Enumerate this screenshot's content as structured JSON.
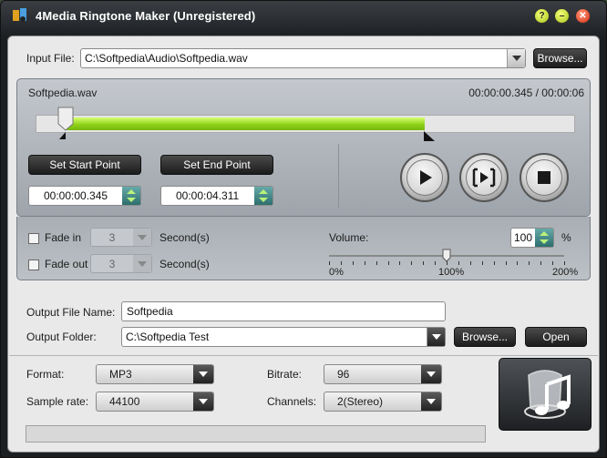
{
  "window": {
    "title": "4Media Ringtone Maker (Unregistered)",
    "help_symbol": "?",
    "min_symbol": "–",
    "close_symbol": "✕"
  },
  "input": {
    "label": "Input File:",
    "value": "C:\\Softpedia\\Audio\\Softpedia.wav",
    "browse_label": "Browse..."
  },
  "clip": {
    "filename": "Softpedia.wav",
    "time_display": "00:00:00.345 / 00:00:06",
    "start_fraction": 0.055,
    "end_fraction": 0.72
  },
  "start": {
    "button_label": "Set Start Point",
    "value": "00:00:00.345"
  },
  "end": {
    "button_label": "Set End Point",
    "value": "00:00:04.311"
  },
  "playback": {
    "play_icon": "play-icon",
    "segment_icon": "play-selection-icon",
    "stop_icon": "stop-icon"
  },
  "fade_in": {
    "label": "Fade in",
    "value": "3",
    "unit": "Second(s)",
    "checked": false
  },
  "fade_out": {
    "label": "Fade out",
    "value": "3",
    "unit": "Second(s)",
    "checked": false
  },
  "volume": {
    "label": "Volume:",
    "value": "100",
    "unit": "%",
    "min_label": "0%",
    "mid_label": "100%",
    "max_label": "200%",
    "level_percent": 100
  },
  "output": {
    "name_label": "Output File Name:",
    "name_value": "Softpedia",
    "folder_label": "Output Folder:",
    "folder_value": "C:\\Softpedia Test",
    "browse_label": "Browse...",
    "open_label": "Open"
  },
  "settings": {
    "format_label": "Format:",
    "format_value": "MP3",
    "bitrate_label": "Bitrate:",
    "bitrate_value": "96",
    "samplerate_label": "Sample rate:",
    "samplerate_value": "44100",
    "channels_label": "Channels:",
    "channels_value": "2(Stereo)"
  },
  "progress": {
    "fraction": 0
  },
  "colors": {
    "accent_green": "#8fd21a",
    "window_dark": "#1c1f22"
  }
}
